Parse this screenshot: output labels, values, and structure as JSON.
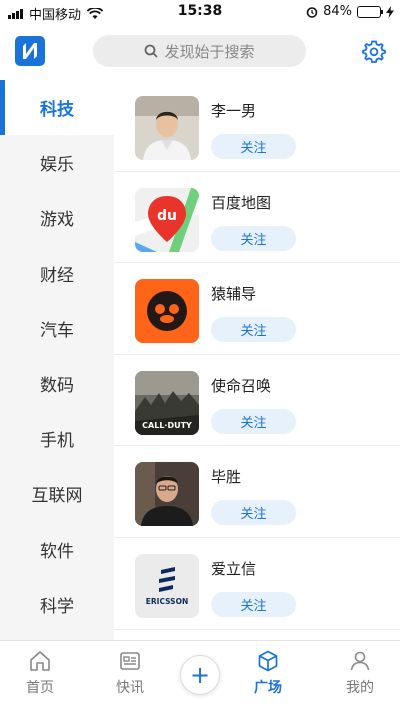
{
  "status_bar": {
    "carrier": "中国移动",
    "time": "15:38",
    "battery_percent": "84%",
    "battery_level": 0.84
  },
  "header": {
    "search_placeholder": "发现始于搜索",
    "icons": {
      "logo": "n-logo-icon",
      "search": "search-icon",
      "settings": "gear-icon"
    }
  },
  "nav": {
    "items": [
      {
        "label": "科技",
        "active": true
      },
      {
        "label": "娱乐"
      },
      {
        "label": "游戏"
      },
      {
        "label": "财经"
      },
      {
        "label": "汽车"
      },
      {
        "label": "数码"
      },
      {
        "label": "手机"
      },
      {
        "label": "互联网"
      },
      {
        "label": "软件"
      },
      {
        "label": "科学"
      }
    ]
  },
  "list": {
    "items": [
      {
        "name": "李一男",
        "action": "关注",
        "thumb": "person-photo"
      },
      {
        "name": "百度地图",
        "action": "关注",
        "thumb": "baidu-maps-logo"
      },
      {
        "name": "猿辅导",
        "action": "关注",
        "thumb": "yuanfudao-logo"
      },
      {
        "name": "使命召唤",
        "action": "关注",
        "thumb": "call-of-duty-cover"
      },
      {
        "name": "毕胜",
        "action": "关注",
        "thumb": "person-photo"
      },
      {
        "name": "爱立信",
        "action": "关注",
        "thumb": "ericsson-logo"
      }
    ]
  },
  "thumb_text": {
    "baidu": "du",
    "cod": "CALL·DUTY",
    "ericsson": "ERICSSON"
  },
  "tabbar": {
    "tabs": [
      {
        "label": "首页",
        "icon": "home-icon"
      },
      {
        "label": "快讯",
        "icon": "news-icon"
      },
      {
        "label": "广场",
        "icon": "cube-icon",
        "active": true
      },
      {
        "label": "我的",
        "icon": "user-icon"
      }
    ],
    "plus_label": "+"
  },
  "colors": {
    "accent": "#1a73d9",
    "follow_bg": "#e6f1fb",
    "nav_bg": "#f5f5f5"
  }
}
